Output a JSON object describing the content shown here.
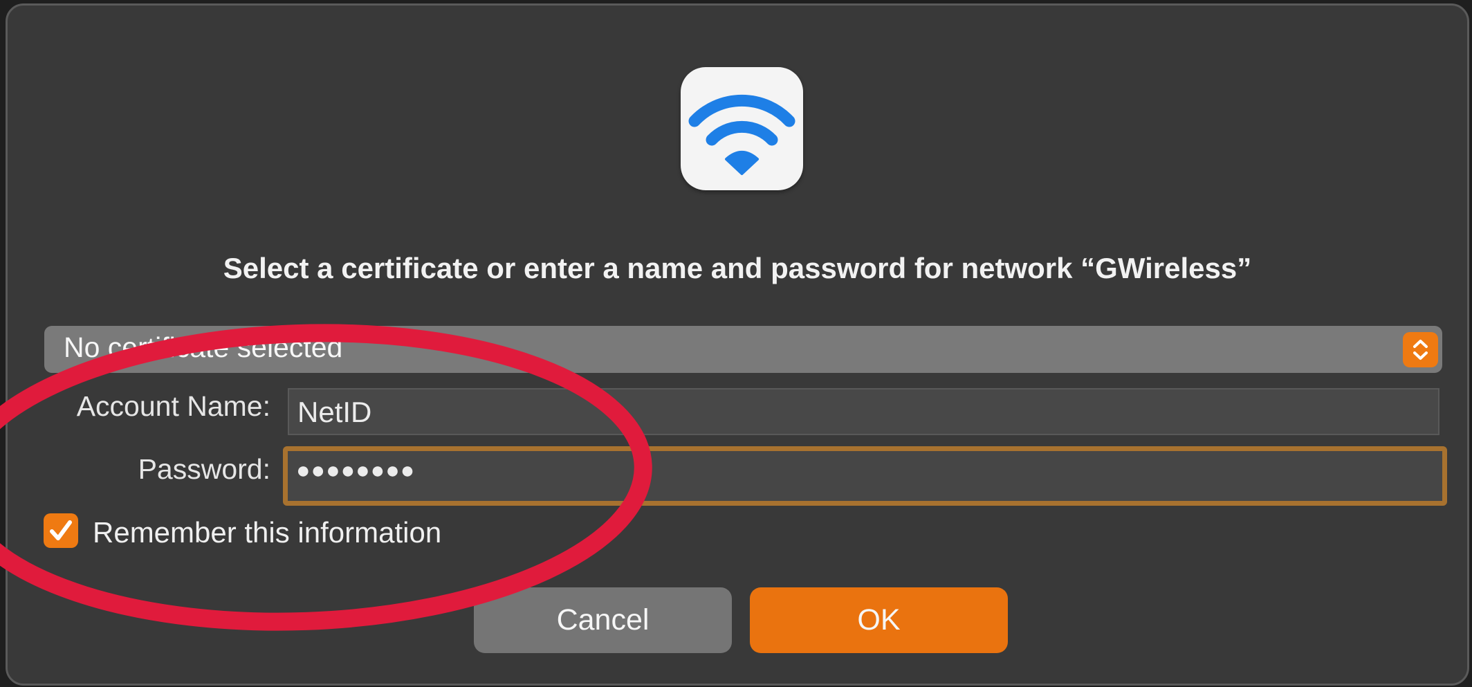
{
  "dialog": {
    "icon": "wifi-icon",
    "title": "Select a certificate or enter a name and password for network “GWireless”",
    "certificate_popup": {
      "selected": "No certificate selected",
      "icon": "stepper-arrows-icon"
    },
    "account_name": {
      "label": "Account Name:",
      "value": "NetID"
    },
    "password": {
      "label": "Password:",
      "value": "●●●●●●●●"
    },
    "remember": {
      "label": "Remember this information",
      "checked": true
    },
    "buttons": {
      "cancel": "Cancel",
      "ok": "OK"
    }
  },
  "colors": {
    "accent": "#ef7a12",
    "focus_ring": "#a8722f",
    "dialog_background": "#393939",
    "annotation": "#e01b3c",
    "wifi_blue": "#1e7fe6"
  }
}
